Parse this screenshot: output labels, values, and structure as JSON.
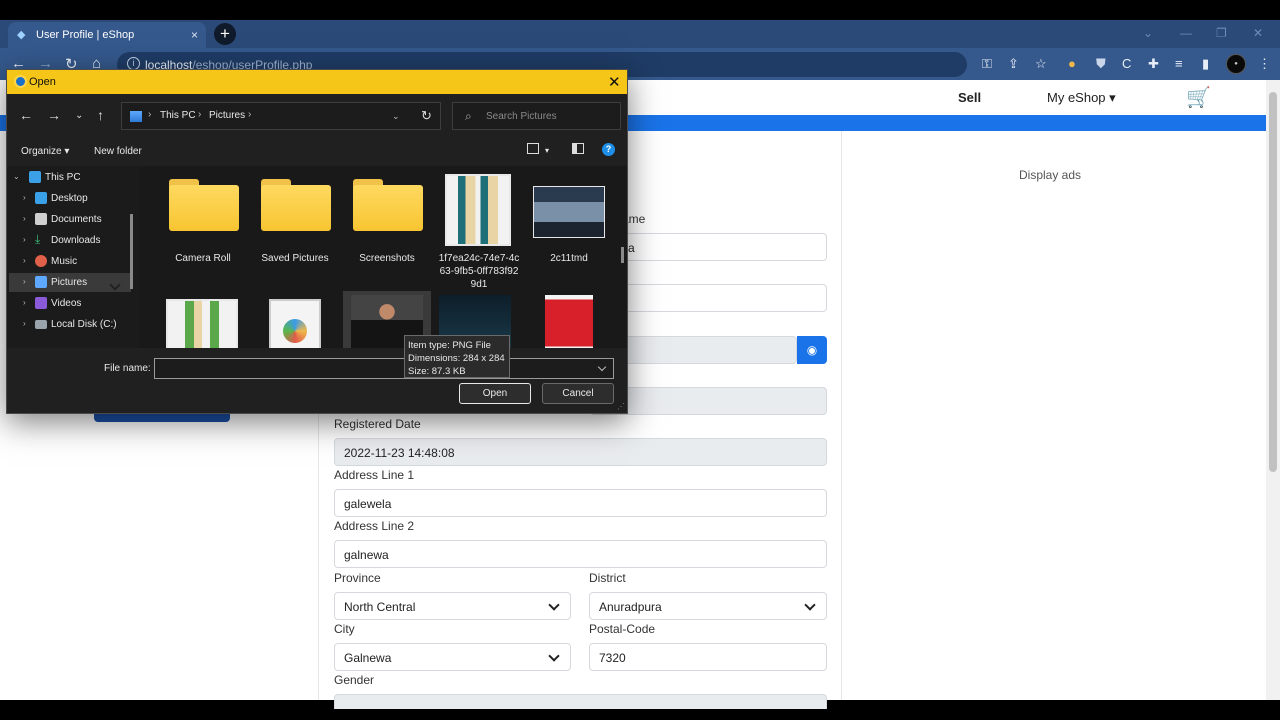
{
  "browser": {
    "tab_title": "User Profile | eShop",
    "tab_close": "×",
    "new_tab": "+",
    "url_host": "localhost",
    "url_path": "/eshop/userProfile.php",
    "controls": {
      "minimize": "—",
      "restore": "❐",
      "close": "✕"
    }
  },
  "nav": {
    "sell": "Sell",
    "my_eshop": "My eShop",
    "cart_icon": "🛒"
  },
  "sidebar_right": {
    "ads": "Display ads"
  },
  "form": {
    "name_label_fragment": "ame",
    "name_value_fragment": "a",
    "registered_date_label": "Registered Date",
    "registered_date": "2022-11-23 14:48:08",
    "address1_label": "Address Line 1",
    "address1": "galewela",
    "address2_label": "Address Line 2",
    "address2": "galnewa",
    "province_label": "Province",
    "province": "North Central",
    "district_label": "District",
    "district": "Anuradpura",
    "city_label": "City",
    "city": "Galnewa",
    "postal_label": "Postal-Code",
    "postal": "7320",
    "gender_label": "Gender"
  },
  "dialog": {
    "title": "Open",
    "close": "✕",
    "breadcrumb": [
      "This PC",
      "Pictures"
    ],
    "search_placeholder": "Search Pictures",
    "organize": "Organize ▾",
    "new_folder": "New folder",
    "help": "?",
    "tree": [
      "This PC",
      "Desktop",
      "Documents",
      "Downloads",
      "Music",
      "Pictures",
      "Videos",
      "Local Disk (C:)"
    ],
    "items": [
      {
        "label": "Camera Roll",
        "kind": "folder"
      },
      {
        "label": "Saved Pictures",
        "kind": "folder"
      },
      {
        "label": "Screenshots",
        "kind": "folder"
      },
      {
        "label": "1f7ea24c-74e7-4c63-9fb5-0ff783f929d1",
        "kind": "image"
      },
      {
        "label": "2c11tmd",
        "kind": "image"
      }
    ],
    "file_name_label": "File name:",
    "file_name_value": "",
    "open": "Open",
    "cancel": "Cancel",
    "tooltip": {
      "type": "Item type: PNG File",
      "dimensions": "Dimensions: 284 x 284",
      "size": "Size: 87.3 KB"
    }
  },
  "colors": {
    "accent": "#1a73e8",
    "dialog_title": "#f5c518",
    "browser_frame": "#35598d"
  }
}
